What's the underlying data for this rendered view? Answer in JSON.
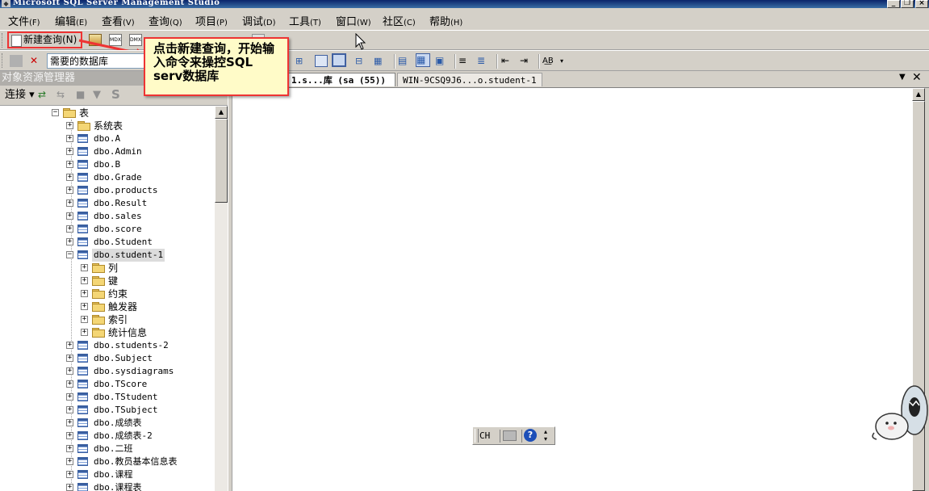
{
  "window": {
    "title": "Microsoft SQL Server Management Studio",
    "controls": [
      "_",
      "❐",
      "×"
    ]
  },
  "menu": [
    {
      "label": "文件",
      "key": "(F)"
    },
    {
      "label": "编辑",
      "key": "(E)"
    },
    {
      "label": "查看",
      "key": "(V)"
    },
    {
      "label": "查询",
      "key": "(Q)"
    },
    {
      "label": "项目",
      "key": "(P)"
    },
    {
      "label": "调试",
      "key": "(D)"
    },
    {
      "label": "工具",
      "key": "(T)"
    },
    {
      "label": "窗口",
      "key": "(W)"
    },
    {
      "label": "社区",
      "key": "(C)"
    },
    {
      "label": "帮助",
      "key": "(H)"
    }
  ],
  "toolbar": {
    "new_query_label": "新建查询(N)",
    "database_selector_value": "需要的数据库"
  },
  "callout": {
    "text": "点击新建查询，开始输入命令来操控SQL serv数据库",
    "border_color": "#e33333"
  },
  "object_explorer": {
    "title": "对象资源管理器",
    "connect_label": "连接",
    "tree": [
      {
        "label": "表",
        "type": "folder",
        "level": 0,
        "expanded": true
      },
      {
        "label": "系统表",
        "type": "folder",
        "level": 1
      },
      {
        "label": "dbo.A",
        "type": "table",
        "level": 1
      },
      {
        "label": "dbo.Admin",
        "type": "table",
        "level": 1
      },
      {
        "label": "dbo.B",
        "type": "table",
        "level": 1
      },
      {
        "label": "dbo.Grade",
        "type": "table",
        "level": 1
      },
      {
        "label": "dbo.products",
        "type": "table",
        "level": 1
      },
      {
        "label": "dbo.Result",
        "type": "table",
        "level": 1
      },
      {
        "label": "dbo.sales",
        "type": "table",
        "level": 1
      },
      {
        "label": "dbo.score",
        "type": "table",
        "level": 1
      },
      {
        "label": "dbo.Student",
        "type": "table",
        "level": 1
      },
      {
        "label": "dbo.student-1",
        "type": "table",
        "level": 1,
        "expanded": true,
        "selected": true
      },
      {
        "label": "列",
        "type": "folder",
        "level": 2
      },
      {
        "label": "键",
        "type": "folder",
        "level": 2
      },
      {
        "label": "约束",
        "type": "folder",
        "level": 2
      },
      {
        "label": "触发器",
        "type": "folder",
        "level": 2
      },
      {
        "label": "索引",
        "type": "folder",
        "level": 2
      },
      {
        "label": "统计信息",
        "type": "folder",
        "level": 2
      },
      {
        "label": "dbo.students-2",
        "type": "table",
        "level": 1
      },
      {
        "label": "dbo.Subject",
        "type": "table",
        "level": 1
      },
      {
        "label": "dbo.sysdiagrams",
        "type": "table",
        "level": 1
      },
      {
        "label": "dbo.TScore",
        "type": "table",
        "level": 1
      },
      {
        "label": "dbo.TStudent",
        "type": "table",
        "level": 1
      },
      {
        "label": "dbo.TSubject",
        "type": "table",
        "level": 1
      },
      {
        "label": "dbo.成绩表",
        "type": "table",
        "level": 1
      },
      {
        "label": "dbo.成绩表-2",
        "type": "table",
        "level": 1
      },
      {
        "label": "dbo.二班",
        "type": "table",
        "level": 1
      },
      {
        "label": "dbo.教员基本信息表",
        "type": "table",
        "level": 1
      },
      {
        "label": "dbo.课程",
        "type": "table",
        "level": 1
      },
      {
        "label": "dbo.课程表",
        "type": "table",
        "level": 1
      }
    ]
  },
  "editor": {
    "tabs": [
      {
        "label": "1.s...库 (sa (55))",
        "active": true
      },
      {
        "label": "WIN-9CSQ9J6...o.student-1",
        "active": false
      }
    ]
  },
  "langbar": {
    "lang": "CH"
  }
}
